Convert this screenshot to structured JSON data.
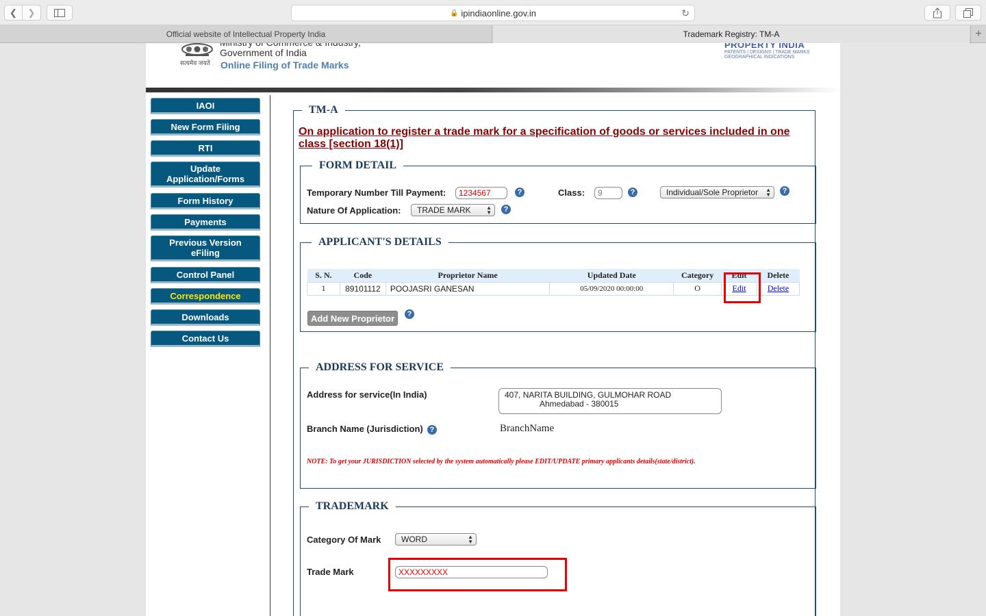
{
  "browser": {
    "url": "ipindiaonline.gov.in",
    "tabs": [
      {
        "label": "Official website of Intellectual Property India"
      },
      {
        "label": "Trademark Registry: TM-A"
      }
    ]
  },
  "header": {
    "ministry": "Ministry of Commerce & Industry,",
    "government": "Government of India",
    "portal": "Online Filing of Trade Marks",
    "emblem_motto": "सत्यमेव जयते",
    "logo_title": "PROPERTY INDIA",
    "logo_sub1": "PATENTS | DESIGNS | TRADE MARKS",
    "logo_sub2": "GEOGRAPHICAL INDICATIONS"
  },
  "menu": [
    {
      "label": "IAOI"
    },
    {
      "label": "New Form Filing"
    },
    {
      "label": "RTI"
    },
    {
      "label": "Update Application/Forms"
    },
    {
      "label": "Form History"
    },
    {
      "label": "Payments"
    },
    {
      "label": "Previous Version eFiling"
    },
    {
      "label": "Control Panel"
    },
    {
      "label": "Correspondence"
    },
    {
      "label": "Downloads"
    },
    {
      "label": "Contact Us"
    }
  ],
  "form": {
    "legend": "TM-A",
    "title": "On application to register a trade mark for a specification of goods or services included in one class [section 18(1)]",
    "form_detail": {
      "legend": "FORM DETAIL",
      "temp_label": "Temporary Number Till Payment:",
      "temp_value": "1234567",
      "class_label": "Class:",
      "class_value": "9",
      "applicant_type": "Individual/Sole Proprietor",
      "nature_label": "Nature Of Application:",
      "nature_value": "TRADE MARK"
    },
    "applicant": {
      "legend": "APPLICANT'S DETAILS",
      "headers": [
        "S. N.",
        "Code",
        "Proprietor Name",
        "Updated Date",
        "Category",
        "Edit",
        "Delete"
      ],
      "row": {
        "sn": "1",
        "code": "89101112",
        "name": "POOJASRI GANESAN",
        "date": "05/09/2020 00:00:00",
        "category": "O",
        "edit": "Edit",
        "delete": "Delete"
      },
      "add_button": "Add New Proprietor"
    },
    "address": {
      "legend": "ADDRESS FOR SERVICE",
      "address_label": "Address for service(In India)",
      "address_line1": "407, NARITA BUILDING, GULMOHAR ROAD",
      "address_line2": "Ahmedabad - 380015",
      "branch_label": "Branch Name (Jurisdiction)",
      "branch_value": "BranchName",
      "note_prefix": "NOTE:",
      "note_text": "To get your JURISDICTION selected by the system automatically please EDIT/UPDATE primary applicants details(state/district)."
    },
    "trademark": {
      "legend": "TRADEMARK",
      "category_label": "Category Of Mark",
      "category_value": "WORD",
      "mark_label": "Trade Mark",
      "mark_value": "XXXXXXXXX"
    }
  },
  "colors": {
    "menu_bg": "#07587e",
    "menu_highlight": "#ffe800",
    "title_red": "#8b0000",
    "annotation_red": "#e00000"
  }
}
